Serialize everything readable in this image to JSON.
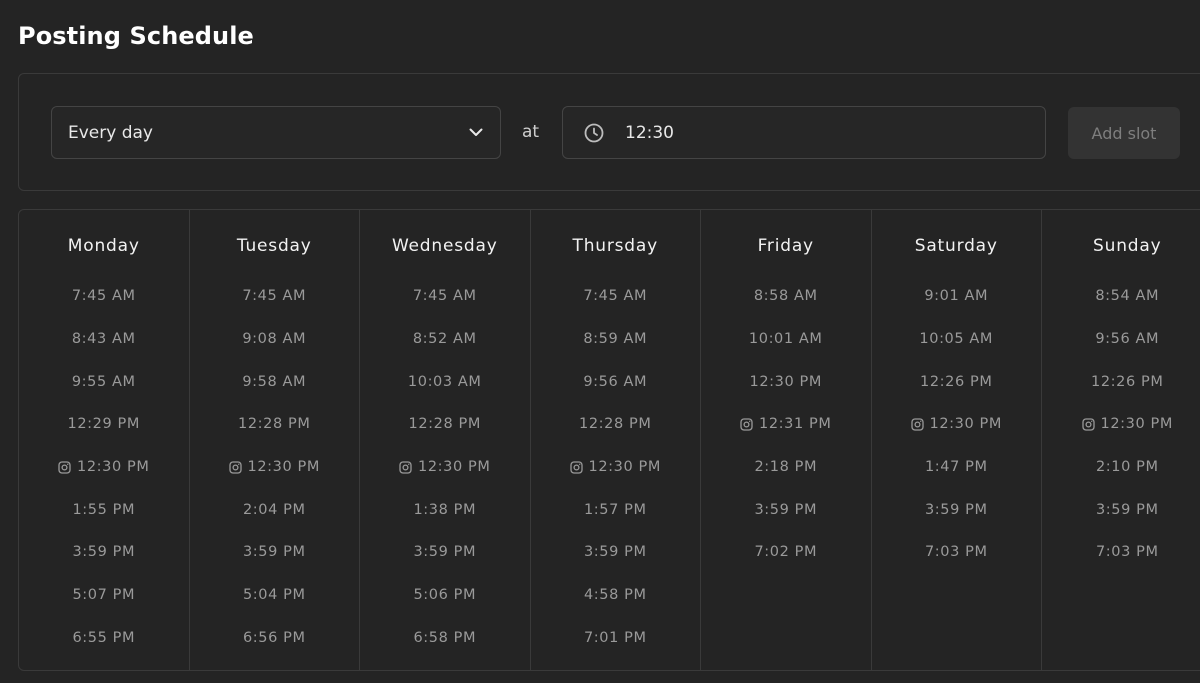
{
  "page": {
    "title": "Posting Schedule"
  },
  "controls": {
    "frequency_value": "Every day",
    "at_label": "at",
    "time_value": "12:30",
    "add_slot_label": "Add slot"
  },
  "icons": {
    "chevron": "chevron-down-icon",
    "clock": "clock-icon",
    "instagram": "instagram-icon"
  },
  "colors": {
    "background": "#242424",
    "border": "#3a3a3a",
    "text_primary": "#f2f2f2",
    "text_muted": "#9a9a9a",
    "button_disabled_bg": "#333333",
    "button_disabled_text": "#7e7e7e"
  },
  "days": [
    {
      "name": "Monday",
      "slots": [
        {
          "time": "7:45 AM",
          "instagram": false
        },
        {
          "time": "8:43 AM",
          "instagram": false
        },
        {
          "time": "9:55 AM",
          "instagram": false
        },
        {
          "time": "12:29 PM",
          "instagram": false
        },
        {
          "time": "12:30 PM",
          "instagram": true
        },
        {
          "time": "1:55 PM",
          "instagram": false
        },
        {
          "time": "3:59 PM",
          "instagram": false
        },
        {
          "time": "5:07 PM",
          "instagram": false
        },
        {
          "time": "6:55 PM",
          "instagram": false
        }
      ]
    },
    {
      "name": "Tuesday",
      "slots": [
        {
          "time": "7:45 AM",
          "instagram": false
        },
        {
          "time": "9:08 AM",
          "instagram": false
        },
        {
          "time": "9:58 AM",
          "instagram": false
        },
        {
          "time": "12:28 PM",
          "instagram": false
        },
        {
          "time": "12:30 PM",
          "instagram": true
        },
        {
          "time": "2:04 PM",
          "instagram": false
        },
        {
          "time": "3:59 PM",
          "instagram": false
        },
        {
          "time": "5:04 PM",
          "instagram": false
        },
        {
          "time": "6:56 PM",
          "instagram": false
        }
      ]
    },
    {
      "name": "Wednesday",
      "slots": [
        {
          "time": "7:45 AM",
          "instagram": false
        },
        {
          "time": "8:52 AM",
          "instagram": false
        },
        {
          "time": "10:03 AM",
          "instagram": false
        },
        {
          "time": "12:28 PM",
          "instagram": false
        },
        {
          "time": "12:30 PM",
          "instagram": true
        },
        {
          "time": "1:38 PM",
          "instagram": false
        },
        {
          "time": "3:59 PM",
          "instagram": false
        },
        {
          "time": "5:06 PM",
          "instagram": false
        },
        {
          "time": "6:58 PM",
          "instagram": false
        }
      ]
    },
    {
      "name": "Thursday",
      "slots": [
        {
          "time": "7:45 AM",
          "instagram": false
        },
        {
          "time": "8:59 AM",
          "instagram": false
        },
        {
          "time": "9:56 AM",
          "instagram": false
        },
        {
          "time": "12:28 PM",
          "instagram": false
        },
        {
          "time": "12:30 PM",
          "instagram": true
        },
        {
          "time": "1:57 PM",
          "instagram": false
        },
        {
          "time": "3:59 PM",
          "instagram": false
        },
        {
          "time": "4:58 PM",
          "instagram": false
        },
        {
          "time": "7:01 PM",
          "instagram": false
        }
      ]
    },
    {
      "name": "Friday",
      "slots": [
        {
          "time": "8:58 AM",
          "instagram": false
        },
        {
          "time": "10:01 AM",
          "instagram": false
        },
        {
          "time": "12:30 PM",
          "instagram": false
        },
        {
          "time": "12:31 PM",
          "instagram": true
        },
        {
          "time": "2:18 PM",
          "instagram": false
        },
        {
          "time": "3:59 PM",
          "instagram": false
        },
        {
          "time": "7:02 PM",
          "instagram": false
        }
      ]
    },
    {
      "name": "Saturday",
      "slots": [
        {
          "time": "9:01 AM",
          "instagram": false
        },
        {
          "time": "10:05 AM",
          "instagram": false
        },
        {
          "time": "12:26 PM",
          "instagram": false
        },
        {
          "time": "12:30 PM",
          "instagram": true
        },
        {
          "time": "1:47 PM",
          "instagram": false
        },
        {
          "time": "3:59 PM",
          "instagram": false
        },
        {
          "time": "7:03 PM",
          "instagram": false
        }
      ]
    },
    {
      "name": "Sunday",
      "slots": [
        {
          "time": "8:54 AM",
          "instagram": false
        },
        {
          "time": "9:56 AM",
          "instagram": false
        },
        {
          "time": "12:26 PM",
          "instagram": false
        },
        {
          "time": "12:30 PM",
          "instagram": true
        },
        {
          "time": "2:10 PM",
          "instagram": false
        },
        {
          "time": "3:59 PM",
          "instagram": false
        },
        {
          "time": "7:03 PM",
          "instagram": false
        }
      ]
    }
  ]
}
